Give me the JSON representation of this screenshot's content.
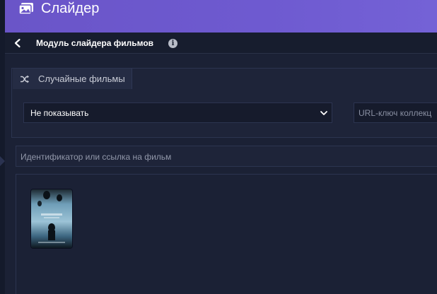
{
  "header": {
    "title": "Слайдер"
  },
  "subbar": {
    "title": "Модуль слайдера фильмов",
    "info": "i"
  },
  "random_films": {
    "tab_label": "Случайные фильмы",
    "select_value": "Не показывать",
    "url_placeholder": "URL-ключ коллекц"
  },
  "film_search": {
    "placeholder": "Идентификатор или ссылка на фильм"
  },
  "films": [
    {
      "poster": "poster-thumbnail"
    }
  ],
  "colors": {
    "header": "#6e5ad0",
    "background": "#1b2135"
  }
}
